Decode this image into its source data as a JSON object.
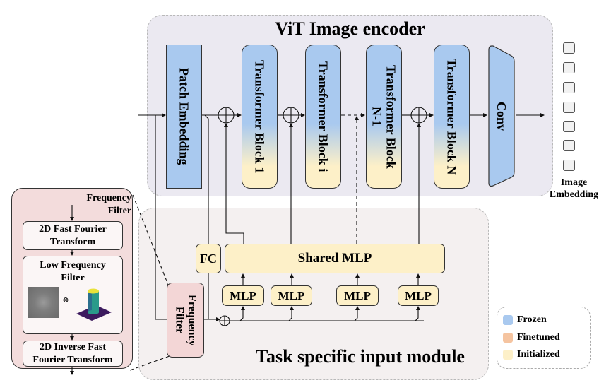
{
  "vit_encoder": {
    "title": "ViT Image encoder",
    "blocks": [
      {
        "id": "patch",
        "label": "Patch Embedding",
        "status": "Frozen"
      },
      {
        "id": "tb1",
        "label": "Transformer Block 1",
        "status": "Frozen/Initialized"
      },
      {
        "id": "tbi",
        "label": "Transformer Block i",
        "status": "Frozen/Initialized"
      },
      {
        "id": "tbn1",
        "label": "Transformer Block N-1",
        "status": "Frozen/Initialized"
      },
      {
        "id": "tbn",
        "label": "Transformer Block N",
        "status": "Frozen/Initialized"
      },
      {
        "id": "conv",
        "label": "Conv",
        "status": "Frozen"
      }
    ]
  },
  "image_embedding": {
    "label": "Image Embedding",
    "token_count": 7
  },
  "task_module": {
    "title": "Task specific input module",
    "fc_label": "FC",
    "shared_mlp_label": "Shared MLP",
    "mlp_labels": [
      "MLP",
      "MLP",
      "MLP",
      "MLP"
    ],
    "frequency_filter_label": "Frequency Filter"
  },
  "frequency_filter_detail": {
    "title": "Frequency Filter",
    "steps": [
      {
        "label": "2D Fast Fourier Transform"
      },
      {
        "label": "Low Frequency Filter"
      },
      {
        "label": "2D Inverse Fast Fourier Transform"
      }
    ],
    "operator_symbol": "⊗"
  },
  "legend": {
    "items": [
      {
        "label": "Frozen",
        "color": "#a9c9ef"
      },
      {
        "label": "Finetuned",
        "color": "#f5c4a0"
      },
      {
        "label": "Initialized",
        "color": "#fdf0c8"
      }
    ]
  },
  "colors": {
    "frozen": "#a9c9ef",
    "finetuned": "#f5c4a0",
    "initialized": "#fdf0c8",
    "filter_panel": "#f3dcdc",
    "vit_background": "#ebe9f1",
    "task_background": "#f4f0f0"
  }
}
